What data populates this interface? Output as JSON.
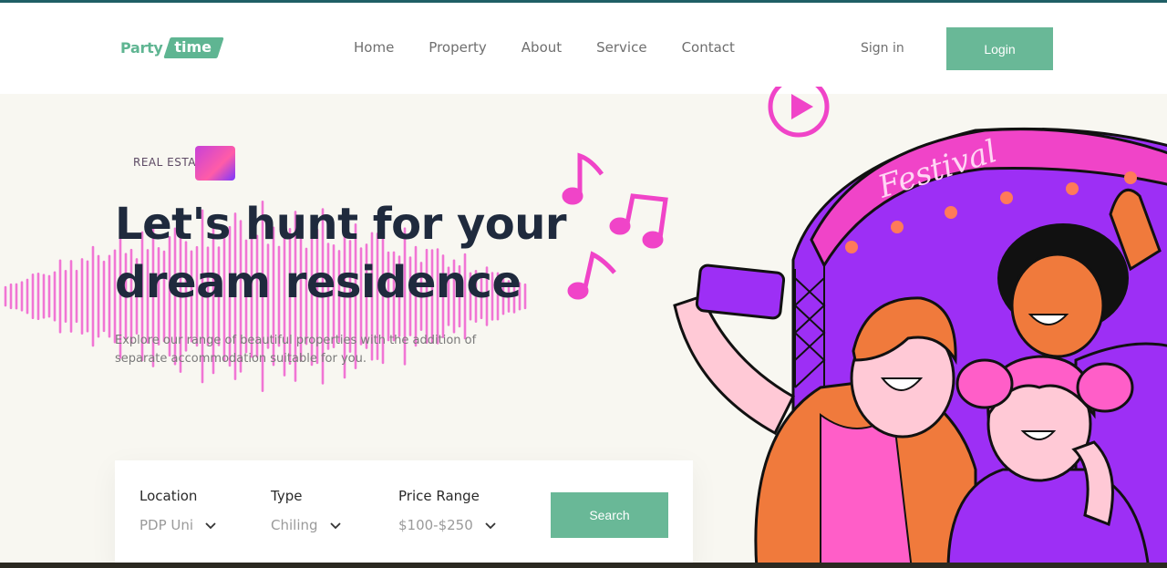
{
  "brand": {
    "part1": "Party",
    "part2": "time",
    "accent": "#69b897"
  },
  "nav": {
    "items": [
      "Home",
      "Property",
      "About",
      "Service",
      "Contact"
    ]
  },
  "auth": {
    "signin": "Sign in",
    "login": "Login"
  },
  "hero": {
    "eyebrow": "REAL ESTATE",
    "title": "Let's hunt for your dream residence",
    "description": "Explore our range of beautiful properties with the addition of separate accommodation suitable for you."
  },
  "search": {
    "fields": [
      {
        "label": "Location",
        "value": "PDP Uni"
      },
      {
        "label": "Type",
        "value": "Chiling"
      },
      {
        "label": "Price Range",
        "value": "$100-$250"
      }
    ],
    "button": "Search"
  },
  "illustration": {
    "banner_text": "Festival"
  }
}
